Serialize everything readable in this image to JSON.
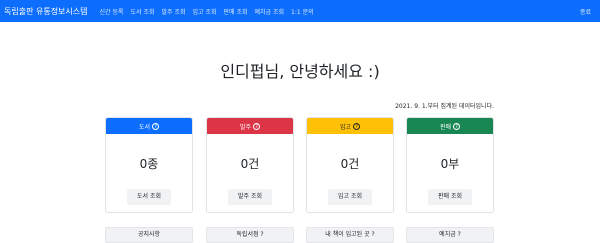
{
  "navbar": {
    "brand": "독립출판 유통정보시스템",
    "links": [
      "신간 등록",
      "도서 조회",
      "발주 조회",
      "입고 조회",
      "판매 조회",
      "예치금 조회",
      "1:1 문의"
    ],
    "logout": "종료",
    "bg": "#0d6efd"
  },
  "greeting": "인디펍님, 안녕하세요 :)",
  "notice": "2021. 9. 1.부터 집계된 데이터입니다.",
  "cards": [
    {
      "title": "도서",
      "value": "0종",
      "button": "도서 조회",
      "color": "#0d6efd",
      "text": "#ffffff"
    },
    {
      "title": "발주",
      "value": "0건",
      "button": "발주 조회",
      "color": "#dc3545",
      "text": "#ffffff"
    },
    {
      "title": "입고",
      "value": "0건",
      "button": "입고 조회",
      "color": "#ffc107",
      "text": "#212529"
    },
    {
      "title": "판매",
      "value": "0부",
      "button": "판매 조회",
      "color": "#198754",
      "text": "#ffffff"
    }
  ],
  "help_icon": "question-circle",
  "bottom_buttons": [
    "공지사항",
    "독립서점 ?",
    "내 책이 입고된 곳 ?",
    "예치금 ?"
  ]
}
